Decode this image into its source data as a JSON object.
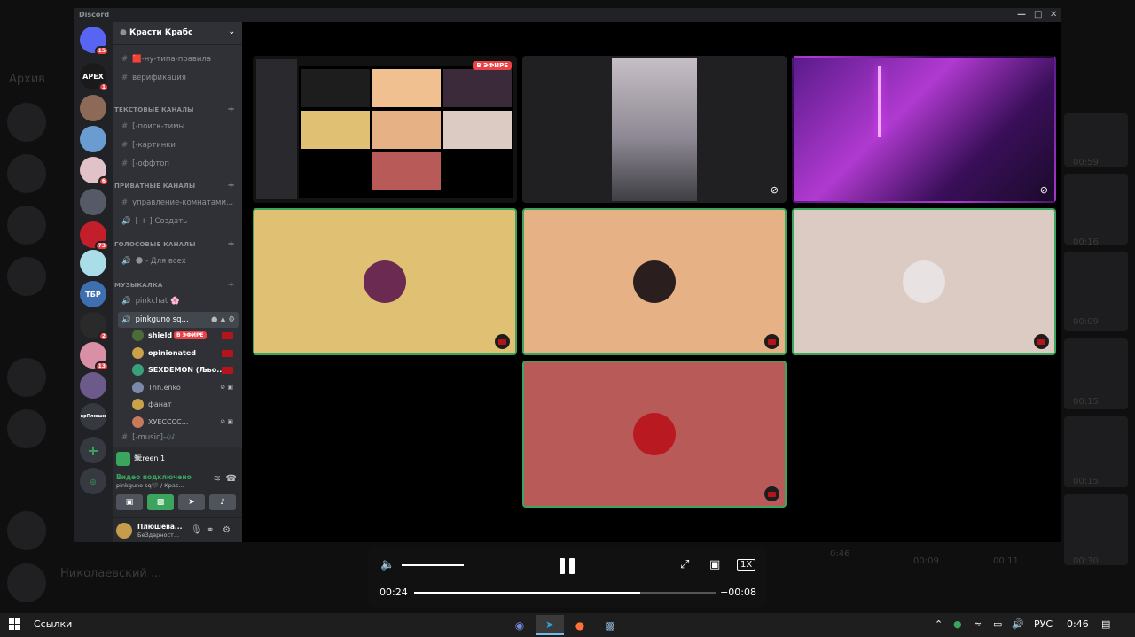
{
  "background_chat": {
    "archive_label": "Архив",
    "chat_name": "Николаевский ...",
    "video_times": [
      "00:59",
      "00:16",
      "00:09",
      "00:15",
      "00:15",
      "00:09",
      "00:11",
      "00:30",
      "0:46"
    ]
  },
  "window": {
    "title": "Discord",
    "minimize_icon": "minimize-icon",
    "maximize_icon": "maximize-icon",
    "close_icon": "close-icon"
  },
  "guilds": [
    {
      "label": "",
      "badge": "15",
      "color": "#5865f2"
    },
    {
      "label": "APEX",
      "badge": "1",
      "color": "#1a1a1a"
    },
    {
      "label": "",
      "badge": "",
      "color": "#8c6a57"
    },
    {
      "label": "",
      "badge": "",
      "color": "#6a9bd1"
    },
    {
      "label": "",
      "badge": "6",
      "color": "#e0c2c8"
    },
    {
      "label": "",
      "badge": "",
      "color": "#555a66"
    },
    {
      "label": "",
      "badge": "73",
      "color": "#c21f2a"
    },
    {
      "label": "",
      "badge": "",
      "color": "#a9dde8"
    },
    {
      "label": "ТБР",
      "badge": "",
      "color": "#3e6fb0"
    },
    {
      "label": "",
      "badge": "2",
      "color": "#2a2a2a"
    },
    {
      "label": "",
      "badge": "13",
      "color": "#d98fa5"
    },
    {
      "label": "",
      "badge": "",
      "color": "#6b5a8a"
    },
    {
      "label": "крПлюши",
      "badge": "",
      "color": "#36393f"
    }
  ],
  "server": {
    "name": "Красти Крабс"
  },
  "channels": {
    "top": [
      {
        "name": "🟥-ну-типа-правила"
      },
      {
        "name": "верификация"
      }
    ],
    "text_category": "ТЕКСТОВЫЕ КАНАЛЫ",
    "text": [
      {
        "name": "[-поиск-тимы"
      },
      {
        "name": "[-картинки"
      },
      {
        "name": "[-оффтоп"
      }
    ],
    "private_category": "ПРИВАТНЫЕ КАНАЛЫ",
    "private": [
      {
        "name": "управление-комнатами..."
      },
      {
        "name": "[ + ] Создать"
      }
    ],
    "voice_category": "ГОЛОСОВЫЕ КАНАЛЫ",
    "voice": [
      {
        "name": "🌑 - Для всех"
      }
    ],
    "music_category": "МУЗЫКАЛКА",
    "music": [
      {
        "name": "pinkchat 🌸"
      },
      {
        "name": "pinkguno sq..."
      }
    ],
    "voice_users": [
      {
        "name": "shield",
        "live": "В ЭФИРЕ",
        "color": "#4a6b3a"
      },
      {
        "name": "opinionated",
        "live": "",
        "color": "#c9a24a"
      },
      {
        "name": "SEXDEMON (Љьо...",
        "live": "",
        "color": "#3aa07a"
      },
      {
        "name": "Thh.enko",
        "live": "",
        "color": "#7a8aa8"
      },
      {
        "name": "фанат",
        "live": "",
        "color": "#c9a24a"
      },
      {
        "name": "ХУЕСССС...",
        "live": "",
        "color": "#c87a5a"
      }
    ],
    "bottom_cut": "[-music]-🎶"
  },
  "rtc": {
    "screen_label": "Screen 1",
    "video_connected": "Видео подключено",
    "channel_sub": "pinkguno sq🖤 / Крас...",
    "buttons": [
      "camera-off-icon",
      "screen-share-icon",
      "activity-icon",
      "soundboard-icon"
    ]
  },
  "user": {
    "name": "Плюшева...",
    "status": "БеЗдарност..."
  },
  "stage": {
    "live_badge": "В ЭФИРЕ",
    "tiles": [
      {
        "kind": "screen",
        "speaking": false
      },
      {
        "kind": "video-cam",
        "speaking": false
      },
      {
        "kind": "video-neon",
        "speaking": false
      },
      {
        "kind": "avatar",
        "bg": "#e0c072",
        "speaking": true,
        "avatar_color": "#6a2a52"
      },
      {
        "kind": "avatar",
        "bg": "#e6b185",
        "speaking": true,
        "avatar_color": "#2a1e1e"
      },
      {
        "kind": "avatar",
        "bg": "#dccbc3",
        "speaking": true,
        "avatar_color": "#e8e2e2"
      },
      {
        "kind": "avatar",
        "bg": "#b85a57",
        "speaking": true,
        "avatar_color": "#b91a22"
      }
    ]
  },
  "media_player": {
    "volume_level": 0.8,
    "current_time": "00:24",
    "remaining_time": "−00:08",
    "progress": 0.75,
    "speed_label": "1X"
  },
  "taskbar": {
    "links_label": "Ссылки",
    "language": "РУС",
    "time": "0:46",
    "apps": [
      "discord-icon",
      "telegram-icon",
      "firefox-icon",
      "app-icon"
    ]
  }
}
